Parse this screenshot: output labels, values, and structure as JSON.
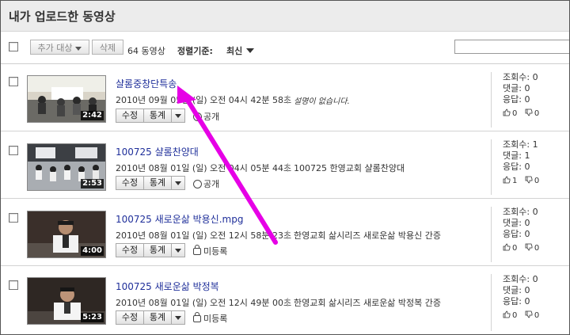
{
  "page": {
    "title": "내가 업로드한 동영상"
  },
  "toolbar": {
    "add_to_label": "추가 대상",
    "delete_label": "삭제",
    "video_count": "64 동영상",
    "sort_label": "정렬기준:",
    "sort_value": "최신"
  },
  "videos": [
    {
      "title": "샬롬중창단특송",
      "date": "2010년 09월 05일 (일) 오전 04시 42분 58초",
      "description": "설명이 없습니다.",
      "duration": "2:42",
      "edit_label": "수정",
      "stats_label": "통계",
      "privacy": "공개",
      "views_label": "조회수:",
      "views": "0",
      "comments_label": "댓글:",
      "comments": "0",
      "responses_label": "응답:",
      "responses": "0",
      "likes": "0",
      "dislikes": "0"
    },
    {
      "title": "100725 샬롬찬양대",
      "date": "2010년 08월 01일 (일) 오전 04시 05분 44초",
      "description": "100725 한영교회 샬롬찬양대",
      "duration": "2:53",
      "edit_label": "수정",
      "stats_label": "통계",
      "privacy": "공개",
      "views_label": "조회수:",
      "views": "1",
      "comments_label": "댓글:",
      "comments": "1",
      "responses_label": "응답:",
      "responses": "0",
      "likes": "1",
      "dislikes": "0"
    },
    {
      "title": "100725 새로운삶 박용신.mpg",
      "date": "2010년 08월 01일 (일) 오전 12시 58분 23초",
      "description": "한영교회 삶시리즈 새로운삶 박용신 간증",
      "duration": "4:00",
      "edit_label": "수정",
      "stats_label": "통계",
      "privacy": "미등록",
      "views_label": "조회수:",
      "views": "0",
      "comments_label": "댓글:",
      "comments": "0",
      "responses_label": "응답:",
      "responses": "0",
      "likes": "0",
      "dislikes": "0"
    },
    {
      "title": "100725 새로운삶 박정복",
      "date": "2010년 08월 01일 (일) 오전 12시 49분 00초",
      "description": "한영교회 삶시리즈 새로운삶 박정복 간증",
      "duration": "5:23",
      "edit_label": "수정",
      "stats_label": "통계",
      "privacy": "미등록",
      "views_label": "조회수:",
      "views": "0",
      "comments_label": "댓글:",
      "comments": "0",
      "responses_label": "응답:",
      "responses": "0",
      "likes": "0",
      "dislikes": "0"
    }
  ],
  "colors": {
    "title_link": "#1f2f9a",
    "annotation_arrow": "#e600e6",
    "header_bg": "#ececec"
  }
}
